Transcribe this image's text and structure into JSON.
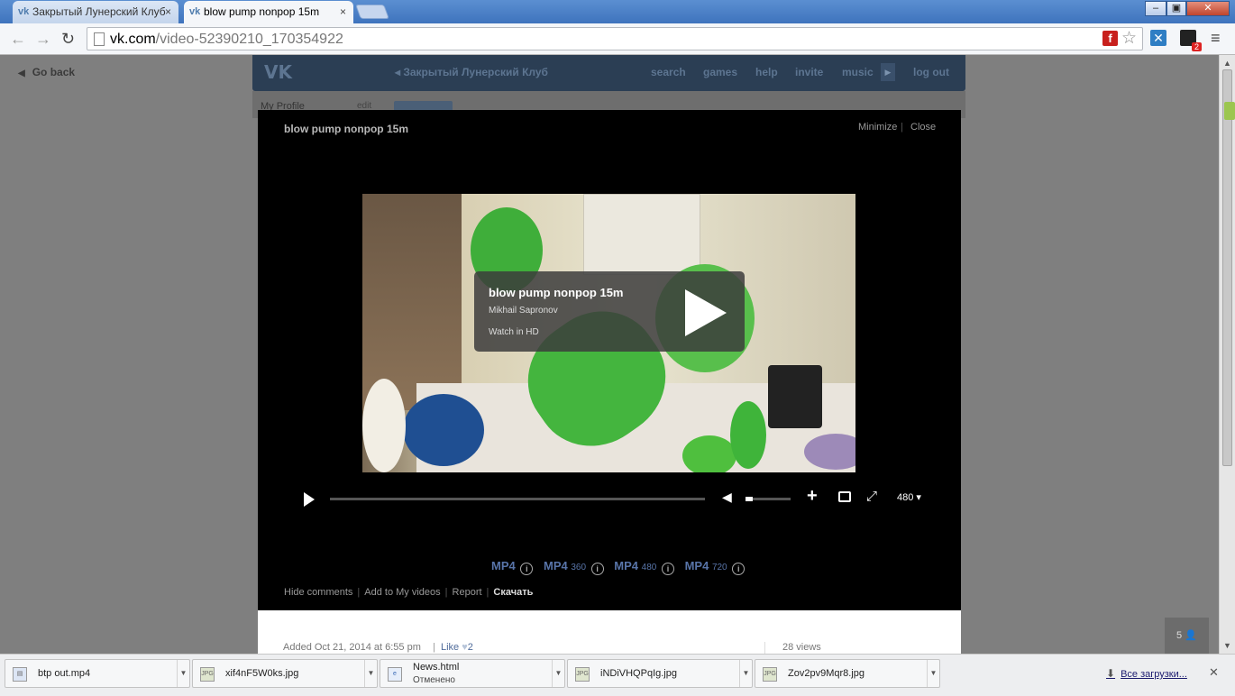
{
  "browser": {
    "tabs": [
      {
        "title": "Закрытый Лунерский Клуб",
        "active": false
      },
      {
        "title": "blow pump nonpop 15m",
        "active": true
      }
    ],
    "tab_close": "×",
    "url_host": "vk.com",
    "url_path": "/video-52390210_170354922",
    "window_buttons": {
      "minimize": "–",
      "maximize": "▣",
      "close": "✕"
    },
    "ext_badge": "2"
  },
  "page": {
    "go_back": "Go back",
    "club_name": "Закрытый Лунерский Клуб",
    "nav": {
      "search": "search",
      "games": "games",
      "help": "help",
      "invite": "invite",
      "music": "music",
      "logout": "log out"
    },
    "my_profile": "My Profile",
    "edit": "edit"
  },
  "video_box": {
    "title": "blow pump nonpop 15m",
    "minimize": "Minimize",
    "close": "Close",
    "overlay": {
      "title": "blow pump nonpop 15m",
      "author": "Mikhail Sapronov",
      "hd": "Watch in HD"
    },
    "controls": {
      "quality": "480",
      "volume_level": 0.15,
      "progress": 0
    },
    "formats": [
      {
        "label": "MP4",
        "res": ""
      },
      {
        "label": "MP4",
        "res": "360"
      },
      {
        "label": "MP4",
        "res": "480"
      },
      {
        "label": "MP4",
        "res": "720"
      }
    ],
    "actions": {
      "hide_comments": "Hide comments",
      "add_to_videos": "Add to My videos",
      "report": "Report",
      "download": "Скачать"
    },
    "info": {
      "added": "Added Oct 21, 2014 at 6:55 pm",
      "like": "Like",
      "like_count": "2",
      "views": "28 views"
    }
  },
  "online_count": "5",
  "downloads": {
    "items": [
      {
        "name": "btp out.mp4",
        "status": ""
      },
      {
        "name": "xif4nF5W0ks.jpg",
        "status": ""
      },
      {
        "name": "News.html",
        "status": "Отменено"
      },
      {
        "name": "iNDiVHQPqIg.jpg",
        "status": ""
      },
      {
        "name": "Zov2pv9Mqr8.jpg",
        "status": ""
      }
    ],
    "show_all": "Все загрузки..."
  }
}
